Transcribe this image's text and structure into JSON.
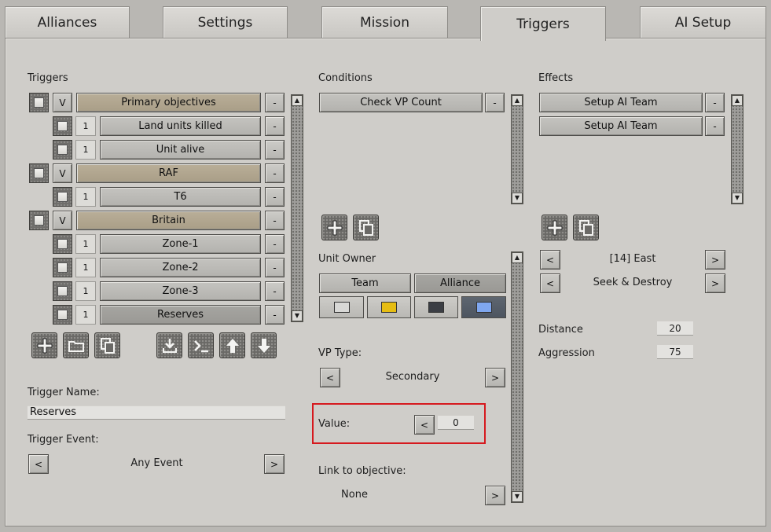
{
  "tabs": [
    "Alliances",
    "Settings",
    "Mission",
    "Triggers",
    "AI Setup"
  ],
  "active_tab": "Triggers",
  "triggers": {
    "title": "Triggers",
    "rows": [
      {
        "type": "group",
        "mark": "V",
        "label": "Primary objectives"
      },
      {
        "type": "item",
        "mark": "1",
        "label": "Land units killed"
      },
      {
        "type": "item",
        "mark": "1",
        "label": "Unit alive"
      },
      {
        "type": "group",
        "mark": "V",
        "label": "RAF"
      },
      {
        "type": "item",
        "mark": "1",
        "label": "T6"
      },
      {
        "type": "group",
        "mark": "V",
        "label": "Britain"
      },
      {
        "type": "item",
        "mark": "1",
        "label": "Zone-1"
      },
      {
        "type": "item",
        "mark": "1",
        "label": "Zone-2"
      },
      {
        "type": "item",
        "mark": "1",
        "label": "Zone-3"
      },
      {
        "type": "item",
        "mark": "1",
        "label": "Reserves"
      }
    ],
    "remove_label": "-",
    "name_label": "Trigger Name:",
    "name_value": "Reserves",
    "event_label": "Trigger Event:",
    "event_value": "Any Event"
  },
  "conditions": {
    "title": "Conditions",
    "items": [
      "Check VP Count"
    ],
    "unit_owner_label": "Unit Owner",
    "owner_team": "Team",
    "owner_alliance": "Alliance",
    "colors": [
      "#d8d8d6",
      "#e6bd12",
      "#3b3e44",
      "#7fa7ef"
    ],
    "vp_type_label": "VP Type:",
    "vp_type_value": "Secondary",
    "value_label": "Value:",
    "value": "0",
    "link_label": "Link to objective:",
    "link_value": "None"
  },
  "effects": {
    "title": "Effects",
    "items": [
      "Setup AI Team",
      "Setup AI Team"
    ],
    "team_value": "[14] East",
    "order_value": "Seek & Destroy",
    "distance_label": "Distance",
    "distance_value": "20",
    "aggression_label": "Aggression",
    "aggression_value": "75"
  },
  "arrows": {
    "left": "<",
    "right": ">"
  }
}
